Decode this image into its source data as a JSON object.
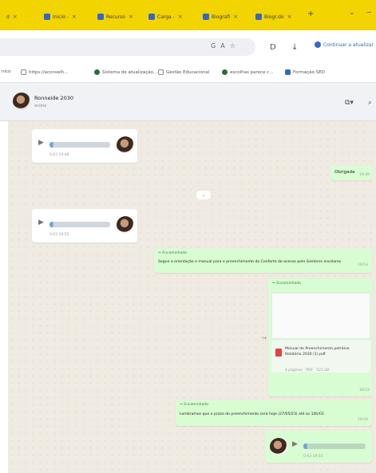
{
  "tabs": [
    {
      "label": "d",
      "x": "×"
    },
    {
      "label": "Inicio -",
      "x": "×"
    },
    {
      "label": "Recurso",
      "x": "×"
    },
    {
      "label": "Carga -",
      "x": "×"
    },
    {
      "label": "Biografi",
      "x": "×"
    },
    {
      "label": "Biogr.do",
      "x": "×"
    }
  ],
  "new_tab": "+",
  "omnibox_icons": [
    "G",
    "A",
    "☆"
  ],
  "toolbar_icons": [
    "D",
    "↓"
  ],
  "profile_label": "Continuar a atualizar",
  "bookmarks": [
    {
      "label": "https://aconselh..."
    },
    {
      "label": "Sistema de atualização..."
    },
    {
      "label": "Gestão Educacional"
    },
    {
      "label": "escolhas parece c..."
    },
    {
      "label": "Formação SED"
    }
  ],
  "bookmarks_lead": "nico",
  "chat_header": {
    "name": "Ronneide 2030",
    "sub": "online",
    "icons": [
      "⧉▾",
      "⌕"
    ]
  },
  "messages": {
    "m1_time": "0:03   19:48",
    "m2_text": "Obrigada",
    "m2_time": "19:49",
    "m3_time": "0:03   19:52",
    "m4_fwd": "↪ Encaminhada",
    "m4_text": "Segue a orientação e manual para o preenchimento do Conforto de acesso pelo Gestores escolares",
    "m4_time": "19:53",
    "m5_fwd": "↪ Encaminhada",
    "m5_file": "Manual de Preenchimento petrónio Relatório 2030 (1).pdf",
    "m5_meta": "4 páginas · PDF · 521 kB",
    "m5_time": "19:53",
    "m6_fwd": "↪ Encaminhada",
    "m6_text": "Lembramos que o prazo do preenchimento será hoje (27/05/23) até as 14h/CE",
    "m6_time": "19:54",
    "m7_time": "0:03   19:55"
  }
}
